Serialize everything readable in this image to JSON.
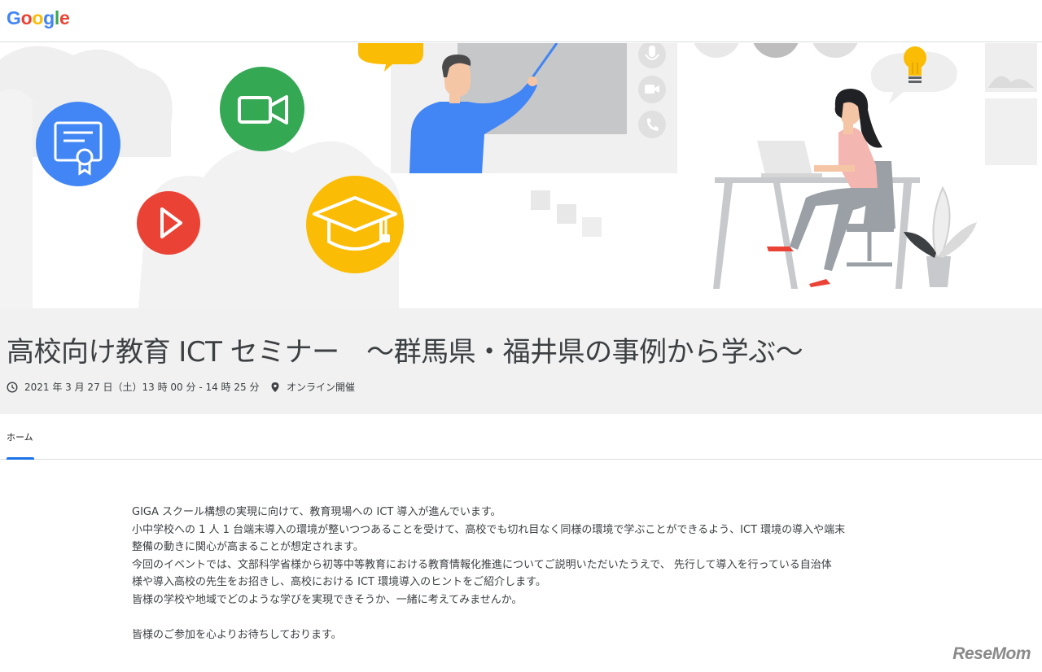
{
  "brand": {
    "letters": [
      {
        "ch": "G",
        "color": "#4285F4"
      },
      {
        "ch": "o",
        "color": "#EA4335"
      },
      {
        "ch": "o",
        "color": "#FBBC05"
      },
      {
        "ch": "g",
        "color": "#4285F4"
      },
      {
        "ch": "l",
        "color": "#34A853"
      },
      {
        "ch": "e",
        "color": "#EA4335"
      }
    ]
  },
  "hero": {
    "icons": [
      "certificate-icon",
      "video-camera-icon",
      "play-icon",
      "graduation-cap-icon",
      "microphone-icon",
      "camera-icon",
      "phone-icon",
      "lightbulb-icon"
    ],
    "colors": {
      "blue": "#4285F4",
      "green": "#34A853",
      "red": "#EA4335",
      "yellow": "#FBBC05",
      "cloud": "#eeeeee",
      "grey": "#c7c9cc"
    }
  },
  "event": {
    "title": "高校向け教育 ICT セミナー　～群馬県・福井県の事例から学ぶ～",
    "datetime": "2021 年 3 月 27 日（土）13 時 00 分 - 14 時 25 分",
    "location": "オンライン開催"
  },
  "tabs": {
    "home": "ホーム",
    "accent": "#1a73e8"
  },
  "body": {
    "lines": [
      "GIGA スクール構想の実現に向けて、教育現場への ICT 導入が進んでいます。",
      "小中学校への 1 人 1 台端末導入の環境が整いつつあることを受けて、高校でも切れ目なく同様の環境で学ぶことができるよう、ICT 環境の導入や端末",
      "整備の動きに関心が高まることが想定されます。",
      "今回のイベントでは、文部科学省様から初等中等教育における教育情報化推進についてご説明いただいたうえで、 先行して導入を行っている自治体",
      "様や導入高校の先生をお招きし、高校における ICT 環境導入のヒントをご紹介します。",
      "皆様の学校や地域でどのような学びを実現できそうか、一緒に考えてみませんか。"
    ],
    "closing": "皆様のご参加を心よりお待ちしております。"
  },
  "watermark": "ReseMom"
}
